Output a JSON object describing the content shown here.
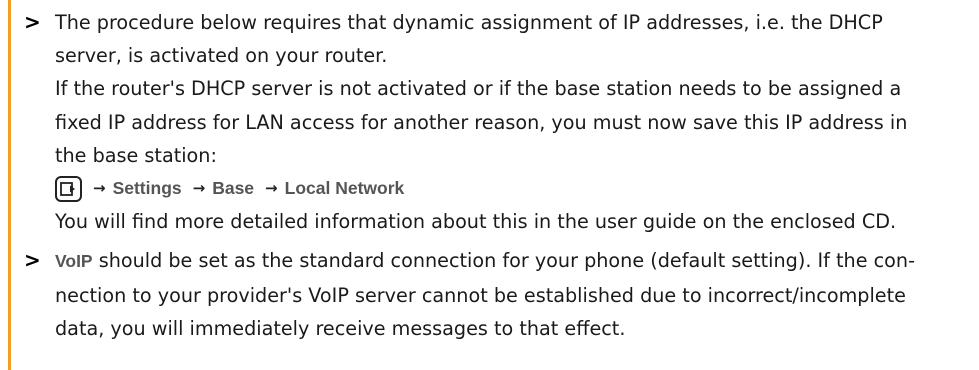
{
  "colors": {
    "accent_bar": "#f0a020",
    "text": "#1a1a1a",
    "ui_term": "#555555"
  },
  "bullet_marker": ">",
  "item1": {
    "line1": "The procedure below requires that dynamic assignment of IP addresses, i.e. the DHCP",
    "line2": "server, is activated on your router.",
    "line3": "If the router's DHCP server is not activated or if the base station needs to be assigned a",
    "line4": "fixed IP address for LAN access for another reason, you must now save this IP address in",
    "line5": "the base station:",
    "nav": {
      "menu_icon": "menu-key-icon",
      "arrow": "→",
      "steps": [
        "Settings",
        "Base",
        "Local Network"
      ]
    },
    "line6": "You will find more detailed information about this in the user guide on the enclosed CD."
  },
  "item2": {
    "term": "VoIP",
    "line1_rest": " should be set as the standard connection for your phone (default setting). If the con-",
    "line2": "nection to your provider's VoIP server cannot be established due to incorrect/incomplete",
    "line3": "data, you will immediately receive messages to that effect."
  }
}
